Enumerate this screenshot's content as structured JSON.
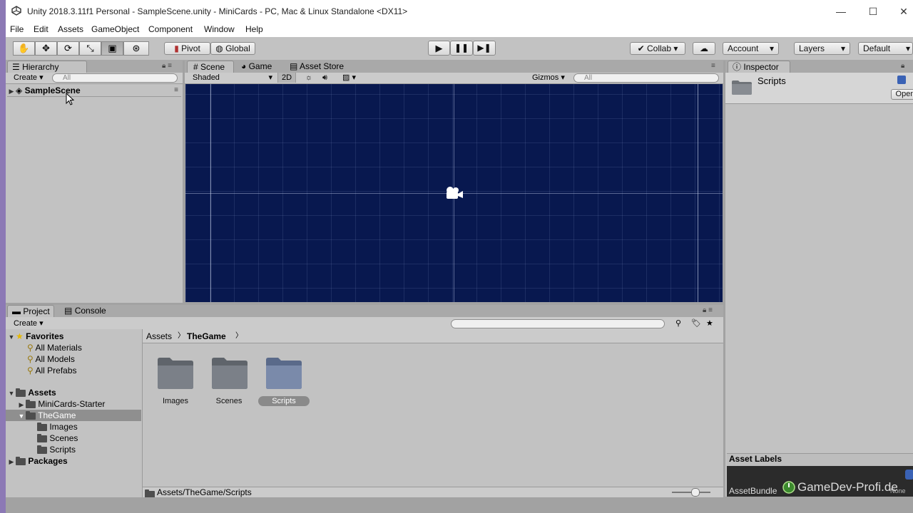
{
  "window": {
    "title": "Unity 2018.3.11f1 Personal - SampleScene.unity - MiniCards - PC, Mac & Linux Standalone <DX11>",
    "minimize": "—",
    "maximize": "☐",
    "close": "✕"
  },
  "menu": [
    "File",
    "Edit",
    "Assets",
    "GameObject",
    "Component",
    "Window",
    "Help"
  ],
  "toolbar": {
    "pivot": "Pivot",
    "global": "Global",
    "collab": "Collab",
    "account": "Account",
    "layers": "Layers",
    "layout": "Default"
  },
  "hierarchy": {
    "tab": "Hierarchy",
    "create": "Create",
    "search_placeholder": "All",
    "scene_name": "SampleScene"
  },
  "scene": {
    "tabs": [
      "Scene",
      "Game",
      "Asset Store"
    ],
    "shading": "Shaded",
    "mode_2d": "2D",
    "gizmos": "Gizmos",
    "search_placeholder": "All"
  },
  "inspector": {
    "tab": "Inspector",
    "title": "Scripts",
    "open_button": "Open",
    "asset_labels": "Asset Labels",
    "asset_bundle": "AssetBundle",
    "bundle_value": "None"
  },
  "project": {
    "tabs": [
      "Project",
      "Console"
    ],
    "create": "Create",
    "tree": {
      "favorites": "Favorites",
      "favorite_items": [
        "All Materials",
        "All Models",
        "All Prefabs"
      ],
      "assets": "Assets",
      "minicards": "MiniCards-Starter",
      "thegame": "TheGame",
      "thegame_children": [
        "Images",
        "Scenes",
        "Scripts"
      ],
      "packages": "Packages"
    },
    "breadcrumb": [
      "Assets",
      "TheGame"
    ],
    "folders": [
      "Images",
      "Scenes",
      "Scripts"
    ],
    "selected_folder": "Scripts",
    "footer_path": "Assets/TheGame/Scripts"
  },
  "watermark": "GameDev-Profi.de"
}
